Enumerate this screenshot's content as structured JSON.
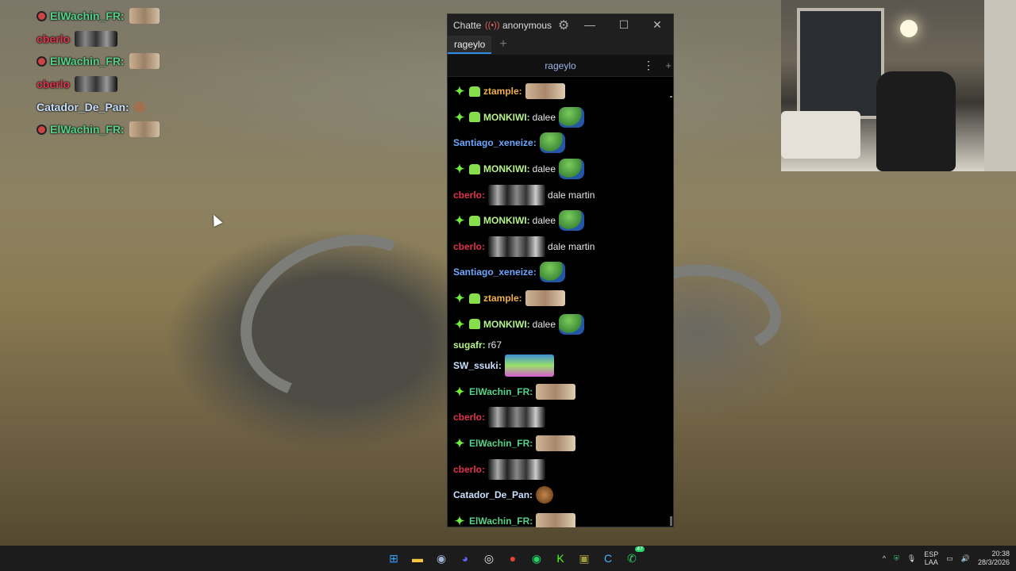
{
  "overlay": {
    "lines": [
      {
        "user": "ElWachin_FR:",
        "color": "#55d28a",
        "badge": true,
        "emote": "cat"
      },
      {
        "user": "cberlo",
        "color": "#e0334d",
        "badge": false,
        "emote": "dark"
      },
      {
        "user": "ElWachin_FR:",
        "color": "#55d28a",
        "badge": true,
        "emote": "cat"
      },
      {
        "user": "cberlo",
        "color": "#e0334d",
        "badge": false,
        "emote": "dark"
      },
      {
        "user": "Catador_De_Pan:",
        "color": "#c9e0ff",
        "badge": false,
        "emote": "small"
      },
      {
        "user": "ElWachin_FR:",
        "color": "#55d28a",
        "badge": true,
        "emote": "cat"
      }
    ]
  },
  "window": {
    "app_name": "Chatterino",
    "account": "anonymous",
    "tab_label": "rageylo",
    "channel": "rageylo",
    "minimize": "—",
    "maximize": "☐",
    "close": "✕",
    "tab_add": "+",
    "split_menu": "⋮",
    "split_add": "+"
  },
  "messages": [
    {
      "user": "ztample:",
      "color": "#f0b04a",
      "sparkle": true,
      "bot": true,
      "text": "",
      "emote": "cat"
    },
    {
      "user": "MONKIWI:",
      "color": "#b6f38c",
      "sparkle": true,
      "bot": true,
      "text": "dalee",
      "emote": "pepe"
    },
    {
      "user": "Santiago_xeneize:",
      "color": "#6fa8ff",
      "sparkle": false,
      "bot": false,
      "text": "",
      "emote": "pepe"
    },
    {
      "user": "MONKIWI:",
      "color": "#b6f38c",
      "sparkle": true,
      "bot": true,
      "text": "dalee",
      "emote": "pepe"
    },
    {
      "user": "cberlo:",
      "color": "#e0334d",
      "sparkle": false,
      "bot": false,
      "text": "dale martin",
      "emote": "dark",
      "emote_first": true
    },
    {
      "user": "MONKIWI:",
      "color": "#b6f38c",
      "sparkle": true,
      "bot": true,
      "text": "dalee",
      "emote": "pepe"
    },
    {
      "user": "cberlo:",
      "color": "#e0334d",
      "sparkle": false,
      "bot": false,
      "text": "dale martin",
      "emote": "dark",
      "emote_first": true
    },
    {
      "user": "Santiago_xeneize:",
      "color": "#6fa8ff",
      "sparkle": false,
      "bot": false,
      "text": "",
      "emote": "pepe"
    },
    {
      "user": "ztample:",
      "color": "#f0b04a",
      "sparkle": true,
      "bot": true,
      "text": "",
      "emote": "cat"
    },
    {
      "user": "MONKIWI:",
      "color": "#b6f38c",
      "sparkle": true,
      "bot": true,
      "text": "dalee",
      "emote": "pepe"
    },
    {
      "user": "sugafr:",
      "color": "#b6f38c",
      "sparkle": false,
      "bot": false,
      "text": "r67",
      "emote": "",
      "short": true
    },
    {
      "user": "SW_ssuki:",
      "color": "#c9e0ff",
      "sparkle": false,
      "bot": false,
      "text": "",
      "emote": "spongebob"
    },
    {
      "user": "ElWachin_FR:",
      "color": "#55d28a",
      "sparkle": true,
      "bot": false,
      "text": "",
      "emote": "cat"
    },
    {
      "user": "cberlo:",
      "color": "#e0334d",
      "sparkle": false,
      "bot": false,
      "text": "",
      "emote": "dark"
    },
    {
      "user": "ElWachin_FR:",
      "color": "#55d28a",
      "sparkle": true,
      "bot": false,
      "text": "",
      "emote": "cat"
    },
    {
      "user": "cberlo:",
      "color": "#e0334d",
      "sparkle": false,
      "bot": false,
      "text": "",
      "emote": "dark"
    },
    {
      "user": "Catador_De_Pan:",
      "color": "#c9e0ff",
      "sparkle": false,
      "bot": false,
      "text": "",
      "emote": "monkey"
    },
    {
      "user": "ElWachin_FR:",
      "color": "#55d28a",
      "sparkle": true,
      "bot": false,
      "text": "",
      "emote": "cat"
    }
  ],
  "taskbar": {
    "apps": [
      {
        "name": "windows-start-icon",
        "glyph": "⊞",
        "color": "#3aa0ff"
      },
      {
        "name": "file-explorer-icon",
        "glyph": "▬",
        "color": "#f5c542"
      },
      {
        "name": "steam-icon",
        "glyph": "◉",
        "color": "#9ab3d6"
      },
      {
        "name": "discord-icon",
        "glyph": "◕",
        "color": "#5865f2"
      },
      {
        "name": "obs-icon",
        "glyph": "◎",
        "color": "#e8e8e8"
      },
      {
        "name": "chrome-icon",
        "glyph": "●",
        "color": "#ea4335"
      },
      {
        "name": "spotify-icon",
        "glyph": "◉",
        "color": "#1ed760"
      },
      {
        "name": "kick-icon",
        "glyph": "K",
        "color": "#53fc18"
      },
      {
        "name": "game-icon",
        "glyph": "▣",
        "color": "#9e9a3a"
      },
      {
        "name": "chatterino-icon",
        "glyph": "C",
        "color": "#4fb5ff"
      },
      {
        "name": "whatsapp-icon",
        "glyph": "✆",
        "color": "#25d366",
        "badge": "47"
      }
    ],
    "tray_lang_top": "ESP",
    "tray_lang_bottom": "LAA",
    "time": "20:38",
    "date": "28/3/2026",
    "chevron": "^"
  }
}
